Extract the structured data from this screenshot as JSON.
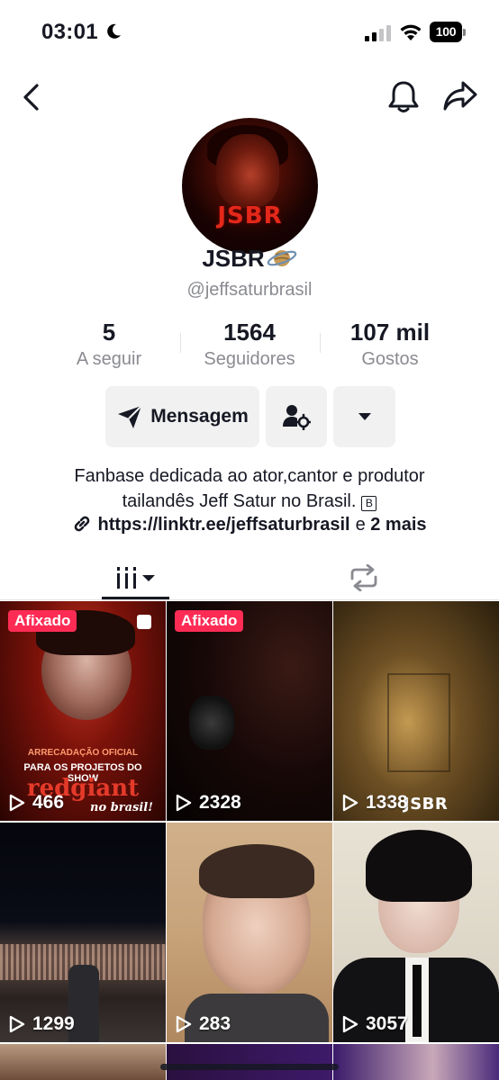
{
  "status_bar": {
    "time": "03:01",
    "battery": "100"
  },
  "nav": {
    "back_icon": "chevron-left-icon",
    "bell_icon": "bell-icon",
    "share_icon": "share-arrow-icon"
  },
  "profile": {
    "avatar_logo": "JSBR",
    "display_name": "JSBR",
    "username": "@jeffsaturbrasil"
  },
  "stats": [
    {
      "value": "5",
      "label": "A seguir"
    },
    {
      "value": "1564",
      "label": "Seguidores"
    },
    {
      "value": "107 mil",
      "label": "Gostos"
    }
  ],
  "actions": {
    "message_label": "Mensagem"
  },
  "bio": {
    "line1": "Fanbase dedicada ao ator,cantor e produtor",
    "line2": "tailandês Jeff Satur no Brasil.",
    "badge": "B",
    "link": "https://linktr.ee/jeffsaturbrasil",
    "more_prefix": "e",
    "more_count": "2 mais"
  },
  "videos": [
    {
      "views": "466",
      "pinned": "Afixado",
      "overlay_top": "ARRECADAÇÃO OFICIAL",
      "overlay_mid": "PARA OS PROJETOS DO SHOW",
      "overlay_title": "redgiant",
      "overlay_sub": "no brasil!"
    },
    {
      "views": "2328",
      "pinned": "Afixado"
    },
    {
      "views": "1338",
      "watermark": "JSBR"
    },
    {
      "views": "1299"
    },
    {
      "views": "283"
    },
    {
      "views": "3057"
    }
  ],
  "colors": {
    "accent": "#fe2c55",
    "text_primary": "#161823",
    "text_secondary": "#8a8b91",
    "button_bg": "#f1f1f2"
  }
}
